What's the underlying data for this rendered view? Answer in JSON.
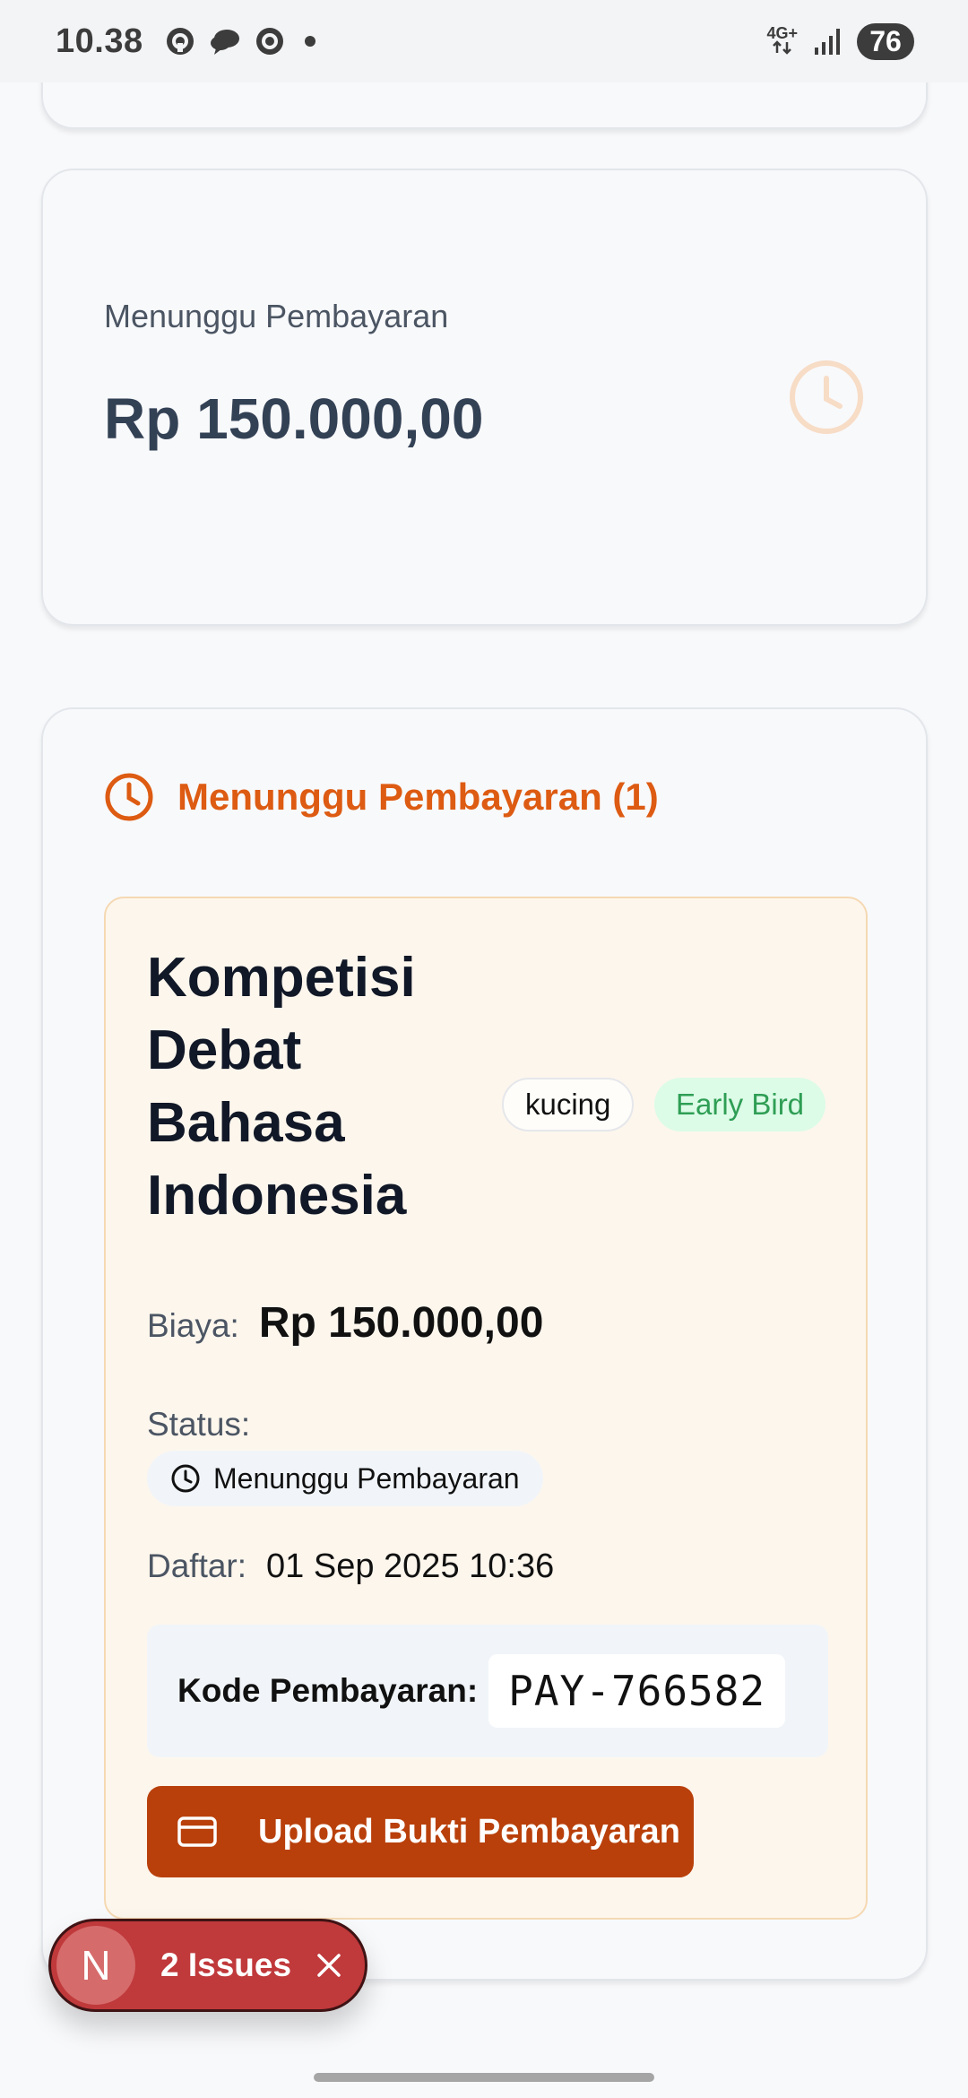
{
  "status_bar": {
    "time": "10.38",
    "network": "4G+",
    "battery": "76"
  },
  "summary_card": {
    "label": "Menunggu Pembayaran",
    "amount": "Rp 150.000,00"
  },
  "pending_section": {
    "title": "Menunggu Pembayaran (1)",
    "registration": {
      "event_title": "Kompetisi Debat Bahasa Indonesia",
      "badge_category": "kucing",
      "badge_type": "Early Bird",
      "fee_label": "Biaya:",
      "fee_value": "Rp 150.000,00",
      "status_label": "Status:",
      "status_value": "Menunggu Pembayaran",
      "date_label": "Daftar:",
      "date_value": "01 Sep 2025 10:36",
      "code_label": "Kode Pembayaran:",
      "code_value": "PAY-766582",
      "upload_button": "Upload Bukti Pembayaran"
    }
  },
  "dev_overlay": {
    "logo": "N",
    "issues": "2 Issues"
  },
  "colors": {
    "accent_orange": "#dd5b12",
    "button_brown": "#b9400b",
    "early_bird_green": "#2f9e55",
    "issues_red": "#c0393b"
  }
}
